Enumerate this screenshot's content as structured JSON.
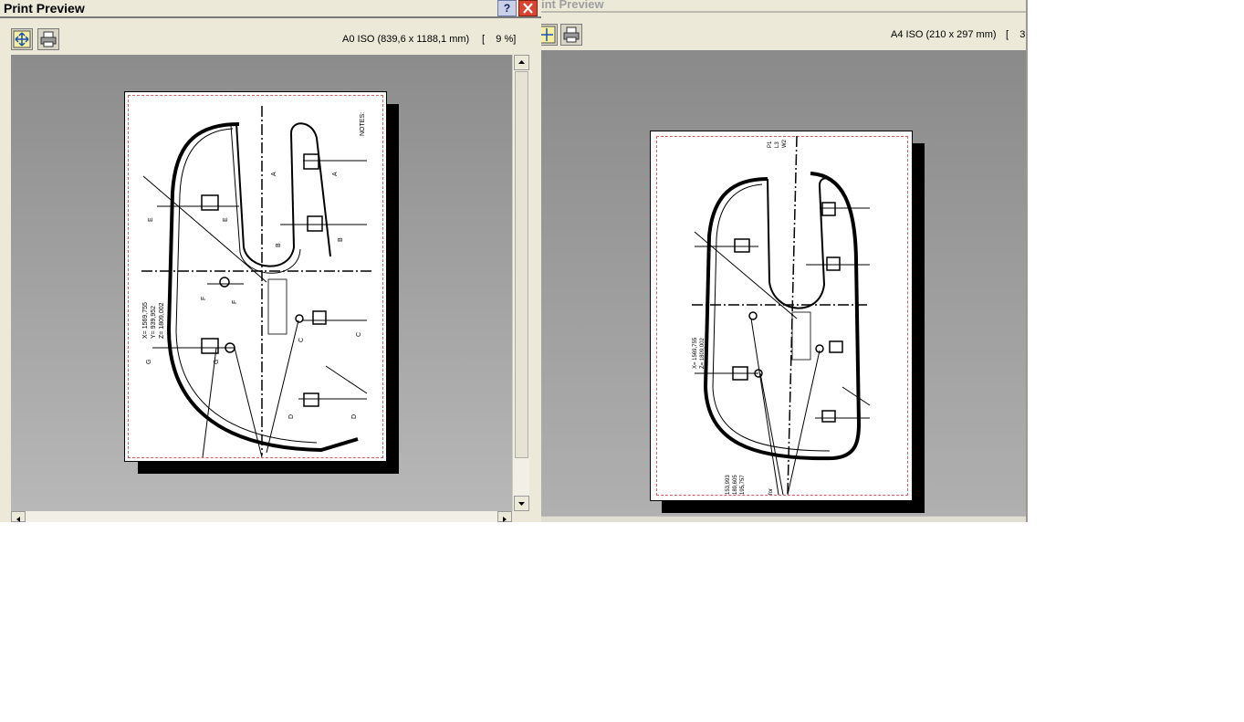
{
  "left_window": {
    "title": "Print Preview",
    "help_button": "?",
    "format_label": "A0 ISO (839,6 x 1188,1 mm)",
    "zoom_label": "[    9 %]",
    "drawing": {
      "notes": "NOTES:",
      "coords": [
        "X= 1569,755",
        "Y= 939,952",
        "Z= 1809,002"
      ],
      "section_letters": [
        "A",
        "A",
        "B",
        "B",
        "C",
        "C",
        "D",
        "D",
        "E",
        "E",
        "F",
        "F",
        "G",
        "G"
      ]
    }
  },
  "right_window": {
    "title": "int Preview",
    "format_label": "A4 ISO (210 x 297 mm)",
    "zoom_label": "[    3",
    "drawing": {
      "coords_top": [
        "X= 1569,755",
        "Z= 1809,002"
      ],
      "coords_bottom": [
        "153,993",
        "189,605",
        "195,757"
      ],
      "side_text": [
        "P1",
        "L3",
        "W2"
      ],
      "footer_text": "for"
    }
  },
  "colors": {
    "chrome": "#ece9d8",
    "close_red": "#d9432f",
    "title_inactive": "#a0a0a0"
  }
}
